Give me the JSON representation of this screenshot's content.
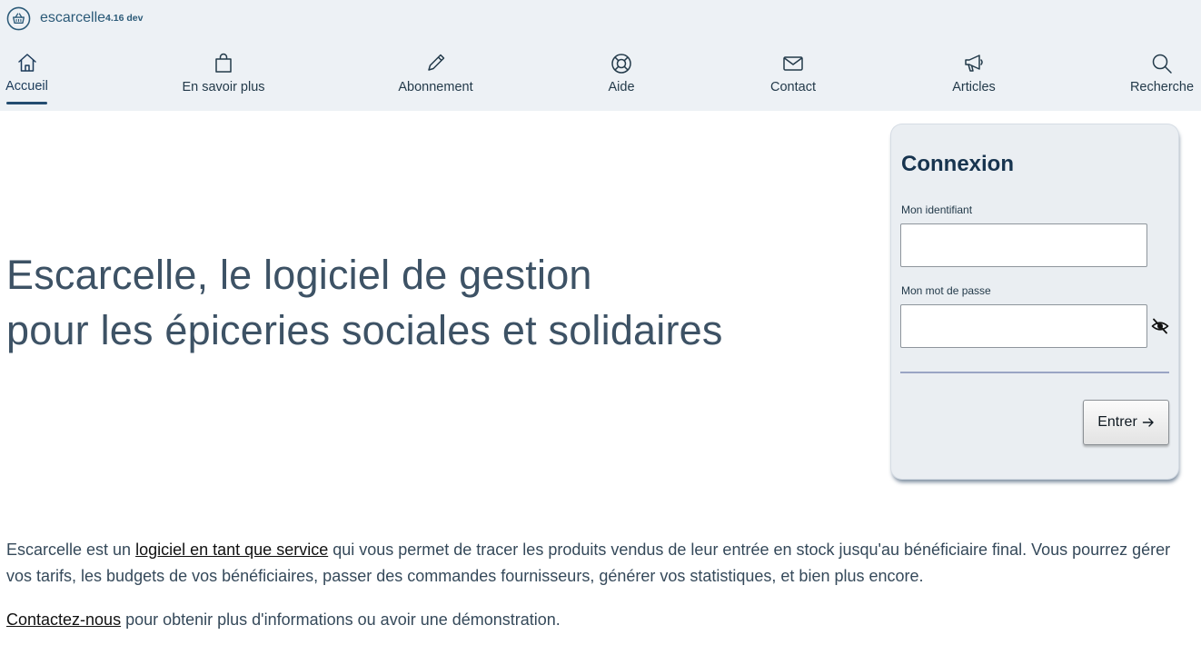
{
  "app": {
    "name": "escarcelle",
    "version": "4.16 dev"
  },
  "nav": {
    "items": [
      {
        "label": "Accueil",
        "icon": "home-icon",
        "active": true
      },
      {
        "label": "En savoir plus",
        "icon": "shopping-bag-icon"
      },
      {
        "label": "Abonnement",
        "icon": "pencil-icon"
      },
      {
        "label": "Aide",
        "icon": "lifebuoy-icon"
      },
      {
        "label": "Contact",
        "icon": "envelope-icon"
      },
      {
        "label": "Articles",
        "icon": "megaphone-icon"
      },
      {
        "label": "Recherche",
        "icon": "search-icon"
      }
    ]
  },
  "hero": {
    "line1": "Escarcelle, le logiciel de gestion",
    "line2": "pour les épiceries sociales et solidaires"
  },
  "login": {
    "title": "Connexion",
    "username_label": "Mon identifiant",
    "username_value": "",
    "password_label": "Mon mot de passe",
    "password_value": "",
    "submit_label": "Entrer",
    "submit_icon": "arrow-right-icon",
    "toggle_icon": "eye-slash-icon"
  },
  "intro": {
    "before_link": "Escarcelle est un ",
    "link_text": "logiciel en tant que service",
    "after_link": " qui vous permet de tracer les produits vendus de leur entrée en stock jusqu'au bénéficiaire final. Vous pourrez gérer vos tarifs, les budgets de vos bénéficiaires, passer des commandes fournisseurs, générer vos statistiques, et bien plus encore."
  },
  "contact": {
    "link_text": "Contactez-nous",
    "after_link": " pour obtenir plus d'informations ou avoir une démonstration."
  },
  "colors": {
    "header_bg": "#edf1f5",
    "brand": "#2b5a78",
    "accent": "#234c70",
    "login_bg": "#eaeef2",
    "text": "#35495a"
  }
}
